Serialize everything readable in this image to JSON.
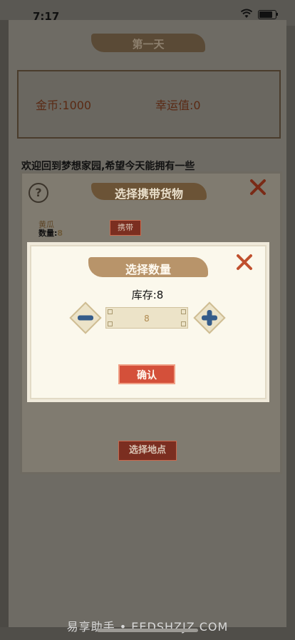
{
  "status_bar": {
    "time": "7:17"
  },
  "game": {
    "day_title": "第一天",
    "gold_label": "金币:1000",
    "luck_label": "幸运值:0",
    "welcome_text": "欢迎回到梦想家园,希望今天能拥有一些"
  },
  "goods_dialog": {
    "title": "选择携带货物",
    "help_symbol": "?",
    "item": {
      "name": "黄瓜",
      "qty_label": "数量:",
      "qty_value": "8"
    },
    "carry_label": "携带",
    "location_label": "选择地点"
  },
  "qty_dialog": {
    "title": "选择数量",
    "stock_label": "库存:8",
    "quantity_value": "8",
    "confirm_label": "确认"
  },
  "watermark": "易享助手 • EEDSHZJZ.COM",
  "colors": {
    "accent_red": "#d4503a",
    "brush_brown": "#b8946a",
    "dialog_bg": "#fbf8ec"
  }
}
